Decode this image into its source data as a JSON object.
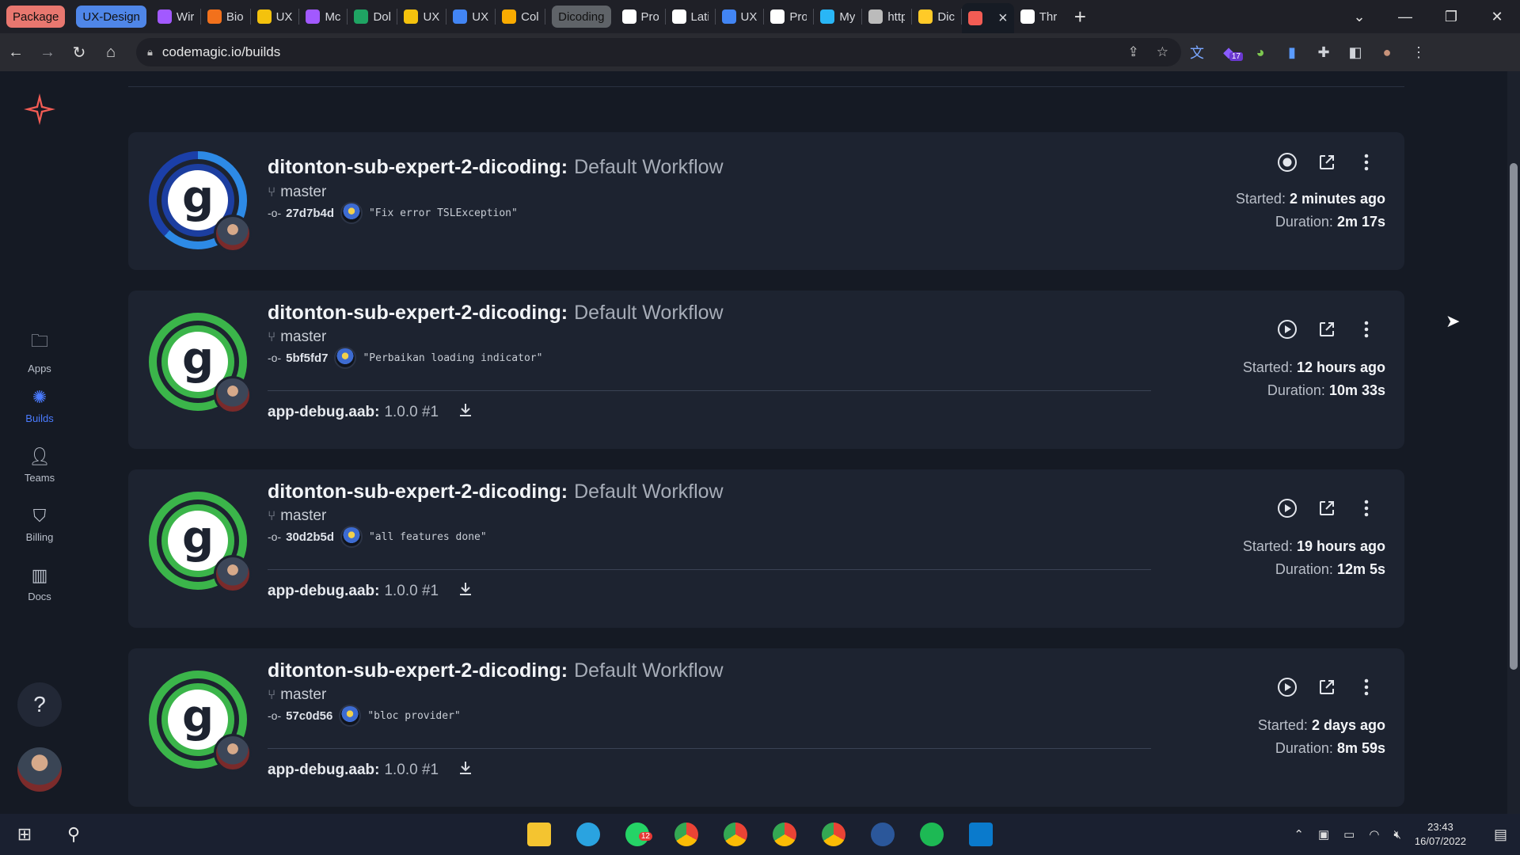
{
  "browser": {
    "tabs": [
      {
        "label": "Package",
        "kind": "group",
        "color": "#e8776f"
      },
      {
        "label": "UX-Design",
        "kind": "group",
        "color": "#4f86e8"
      },
      {
        "label": "Wir",
        "color": "#a259ff",
        "icon": "figma-icon"
      },
      {
        "label": "Bio",
        "color": "#f2711c",
        "icon": "blogger-icon"
      },
      {
        "label": "UX",
        "color": "#f4c20d",
        "icon": "slides-icon"
      },
      {
        "label": "Mc",
        "color": "#a259ff",
        "icon": "figma-icon"
      },
      {
        "label": "Dok",
        "color": "#1fa463",
        "icon": "drive-icon"
      },
      {
        "label": "UX",
        "color": "#f4c20d",
        "icon": "slides-icon"
      },
      {
        "label": "UX",
        "color": "#4285f4",
        "icon": "docs-icon"
      },
      {
        "label": "Col",
        "color": "#f9ab00",
        "icon": "colab-icon"
      },
      {
        "label": "Dicoding",
        "kind": "group",
        "color": "#5f6368"
      },
      {
        "label": "Pro",
        "color": "#ffffff",
        "icon": "codemagic-g-icon"
      },
      {
        "label": "Lati",
        "color": "#ffffff",
        "icon": "codemagic-g-icon"
      },
      {
        "label": "UX",
        "color": "#4285f4",
        "icon": "docs-icon"
      },
      {
        "label": "Pro",
        "color": "#ffffff",
        "icon": "codemagic-g-icon"
      },
      {
        "label": "My",
        "color": "#29b6f6",
        "icon": "bar-icon"
      },
      {
        "label": "http",
        "color": "#bbbbbb",
        "icon": "globe-icon"
      },
      {
        "label": "Dic",
        "color": "#ffca28",
        "icon": "firebase-icon"
      },
      {
        "label": "",
        "color": "#f25c54",
        "icon": "codemagic-icon",
        "active": true
      },
      {
        "label": "Thr",
        "color": "#ffffff",
        "icon": "github-icon"
      }
    ],
    "url": "codemagic.io/builds"
  },
  "extensions_badge": "17",
  "sidebar": {
    "items": [
      {
        "label": "Apps",
        "icon": "apps-icon"
      },
      {
        "label": "Builds",
        "icon": "builds-icon",
        "active": true
      },
      {
        "label": "Teams",
        "icon": "teams-icon"
      },
      {
        "label": "Billing",
        "icon": "billing-icon"
      },
      {
        "label": "Docs",
        "icon": "docs-icon"
      }
    ],
    "help_label": "?"
  },
  "builds": [
    {
      "app": "ditonton-sub-expert-2-dicoding:",
      "workflow": "Default Workflow",
      "branch": "master",
      "commit": "27d7b4d",
      "message": "\"Fix error TSLException\"",
      "status": "running",
      "started_label": "Started:",
      "started": "2 minutes ago",
      "duration_label": "Duration:",
      "duration": "2m 17s"
    },
    {
      "app": "ditonton-sub-expert-2-dicoding:",
      "workflow": "Default Workflow",
      "branch": "master",
      "commit": "5bf5fd7",
      "message": "\"Perbaikan loading indicator\"",
      "status": "success",
      "artifact_name": "app-debug.aab:",
      "artifact_version": "1.0.0 #1",
      "started_label": "Started:",
      "started": "12 hours ago",
      "duration_label": "Duration:",
      "duration": "10m 33s"
    },
    {
      "app": "ditonton-sub-expert-2-dicoding:",
      "workflow": "Default Workflow",
      "branch": "master",
      "commit": "30d2b5d",
      "message": "\"all features done\"",
      "status": "success",
      "artifact_name": "app-debug.aab:",
      "artifact_version": "1.0.0 #1",
      "started_label": "Started:",
      "started": "19 hours ago",
      "duration_label": "Duration:",
      "duration": "12m 5s"
    },
    {
      "app": "ditonton-sub-expert-2-dicoding:",
      "workflow": "Default Workflow",
      "branch": "master",
      "commit": "57c0d56",
      "message": "\"bloc provider\"",
      "status": "success",
      "artifact_name": "app-debug.aab:",
      "artifact_version": "1.0.0 #1",
      "started_label": "Started:",
      "started": "2 days ago",
      "duration_label": "Duration:",
      "duration": "8m 59s"
    }
  ],
  "taskbar": {
    "whatsapp_badge": "12",
    "time": "23:43",
    "date": "16/07/2022"
  },
  "colors": {
    "accent": "#4a7bff",
    "success": "#3bb54a",
    "running": "#2d8ae6",
    "brand": "#f25c54"
  }
}
